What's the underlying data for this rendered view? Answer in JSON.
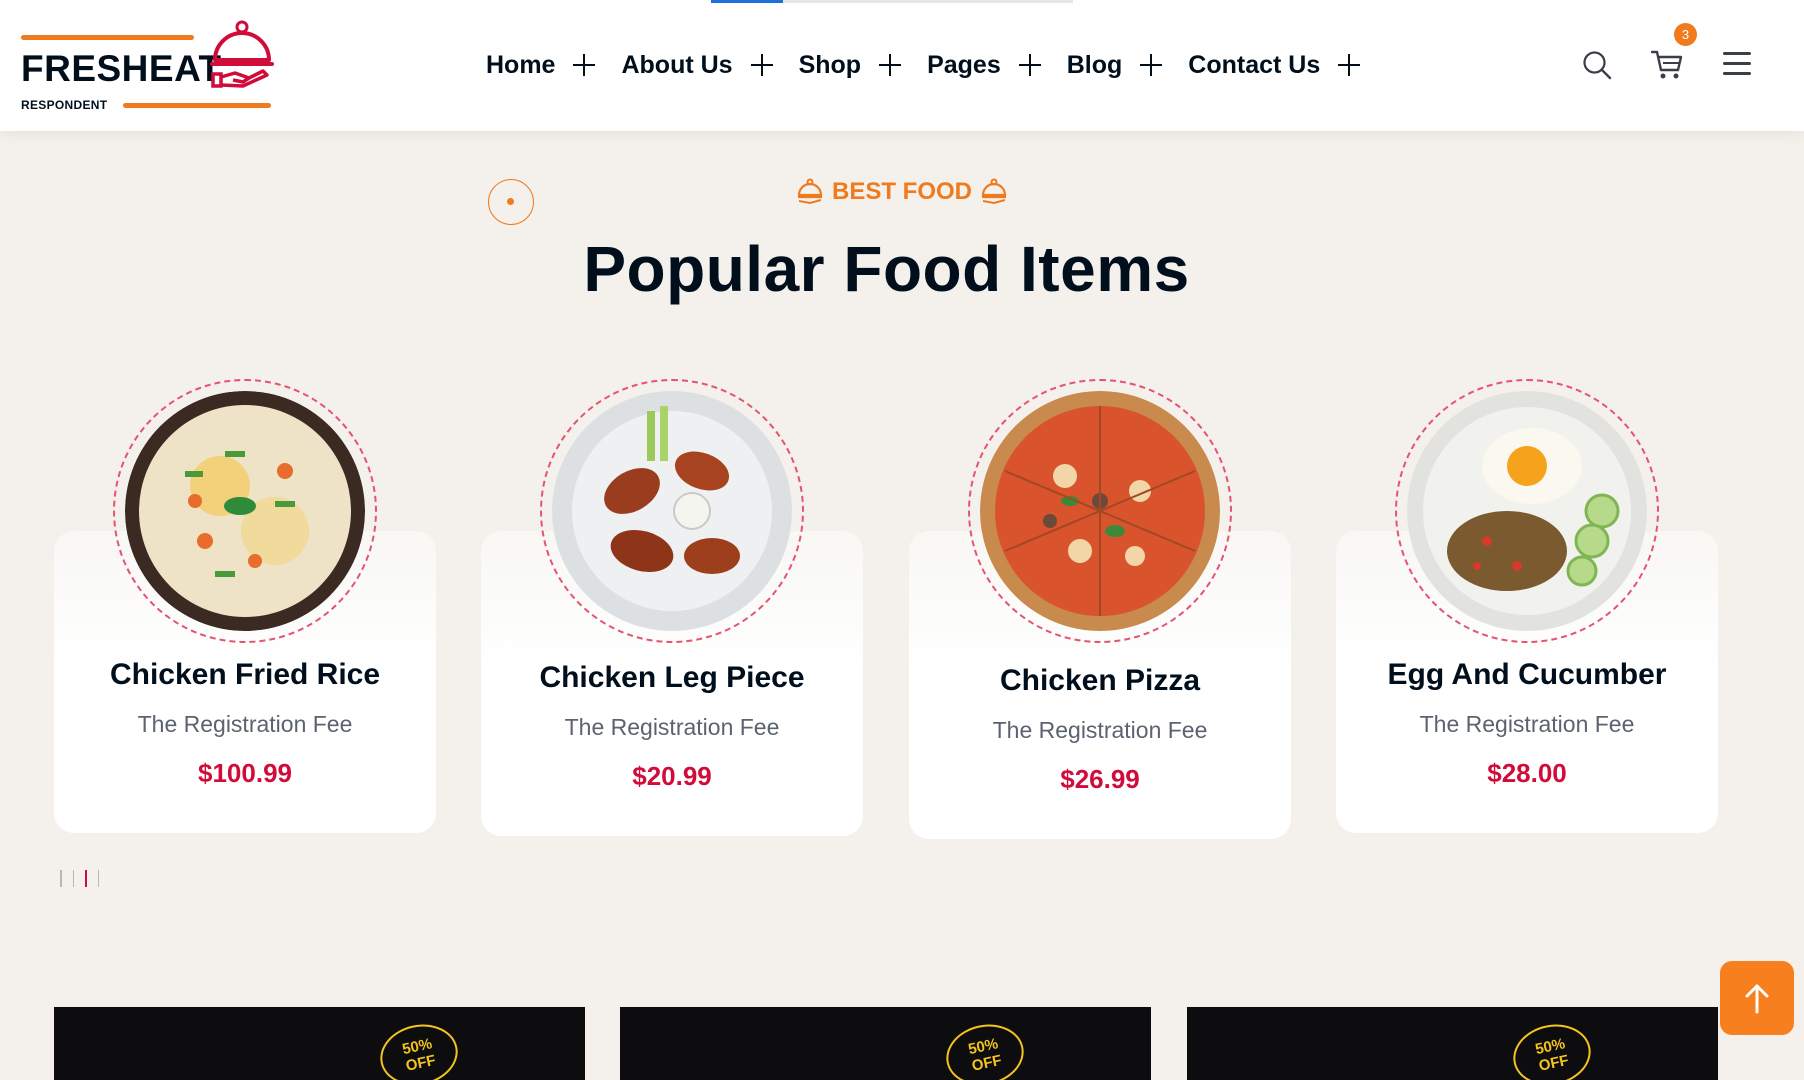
{
  "brand": {
    "name": "FRESHEAT",
    "tagline": "RESPONDENT",
    "accent": "#f07a1e",
    "logo_icon": "cloche-hand-icon"
  },
  "nav": {
    "items": [
      {
        "label": "Home"
      },
      {
        "label": "About Us"
      },
      {
        "label": "Shop"
      },
      {
        "label": "Pages"
      },
      {
        "label": "Blog"
      },
      {
        "label": "Contact Us"
      }
    ]
  },
  "header_actions": {
    "search_icon": "search-icon",
    "cart_icon": "cart-icon",
    "cart_count": "3",
    "menu_icon": "hamburger-menu-icon"
  },
  "section": {
    "kicker": "BEST FOOD",
    "title": "Popular Food Items"
  },
  "foods": [
    {
      "name": "Chicken Fried Rice",
      "desc": "The Registration Fee",
      "price": "$100.99"
    },
    {
      "name": "Chicken Leg Piece",
      "desc": "The Registration Fee",
      "price": "$20.99"
    },
    {
      "name": "Chicken Pizza",
      "desc": "The Registration Fee",
      "price": "$26.99"
    },
    {
      "name": "Egg And Cucumber",
      "desc": "The Registration Fee",
      "price": "$28.00"
    }
  ],
  "pager": {
    "count": 4,
    "active": 2
  },
  "promo": {
    "badge_line1": "50%",
    "badge_line2": "OFF"
  },
  "colors": {
    "page_bg": "#f4f1ec",
    "price": "#d10c3a",
    "ring": "#e45472",
    "scroll_top_bg": "#f77f1d"
  }
}
